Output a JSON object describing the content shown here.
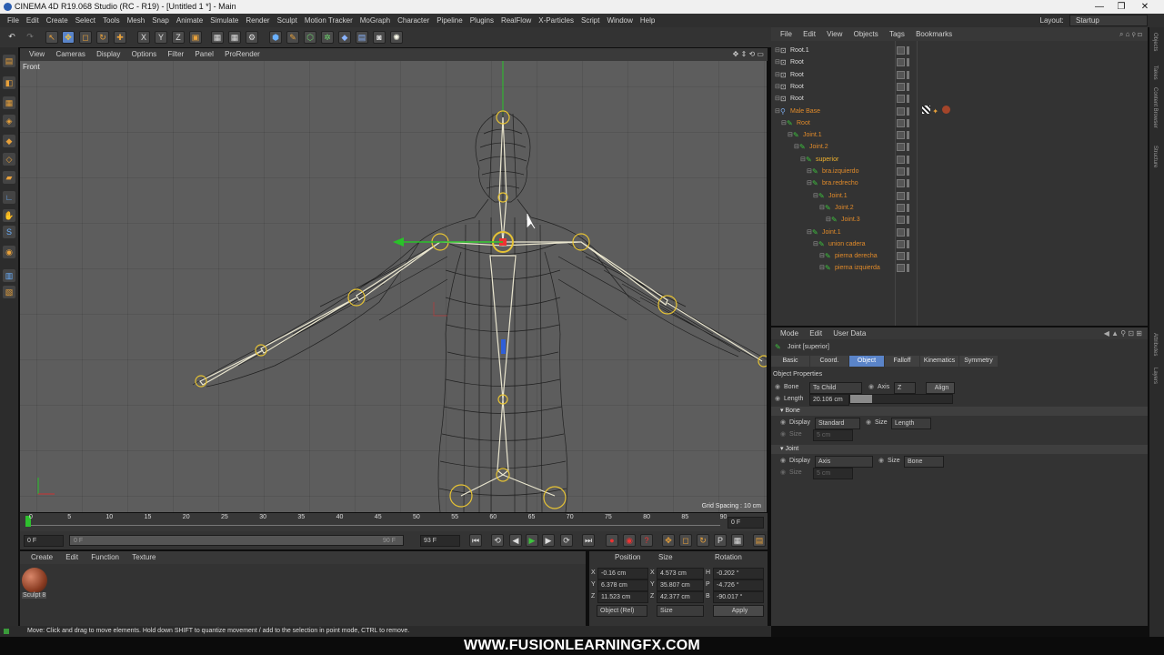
{
  "window": {
    "title": "CINEMA 4D R19.068 Studio (RC - R19) - [Untitled 1 *] - Main",
    "minimize": "—",
    "restore": "❐",
    "close": "✕"
  },
  "menubar": {
    "items": [
      "File",
      "Edit",
      "Create",
      "Select",
      "Tools",
      "Mesh",
      "Snap",
      "Animate",
      "Simulate",
      "Render",
      "Sculpt",
      "Motion Tracker",
      "MoGraph",
      "Character",
      "Pipeline",
      "Plugins",
      "RealFlow",
      "X-Particles",
      "Script",
      "Window",
      "Help"
    ],
    "layout_label": "Layout:",
    "layout_value": "Startup"
  },
  "viewport": {
    "menu": [
      "View",
      "Cameras",
      "Display",
      "Options",
      "Filter",
      "Panel",
      "ProRender"
    ],
    "view_name": "Front",
    "grid_spacing": "Grid Spacing : 10 cm"
  },
  "timeline": {
    "ticks": [
      "0",
      "5",
      "10",
      "15",
      "20",
      "25",
      "30",
      "35",
      "40",
      "45",
      "50",
      "55",
      "60",
      "65",
      "70",
      "75",
      "80",
      "85",
      "90"
    ],
    "end_field": "0 F"
  },
  "transport": {
    "start": "0 F",
    "slider_left": "0 F",
    "slider_right": "90 F",
    "end": "93 F"
  },
  "material_manager": {
    "menu": [
      "Create",
      "Edit",
      "Function",
      "Texture"
    ],
    "material_name": "Sculpt 8"
  },
  "coordinates": {
    "headers": [
      "Position",
      "Size",
      "Rotation"
    ],
    "rows": [
      {
        "axis": "X",
        "pos": "-0.16 cm",
        "size_axis": "X",
        "size": "4.573 cm",
        "rot_axis": "H",
        "rot": "-0.202 °"
      },
      {
        "axis": "Y",
        "pos": "6.378 cm",
        "size_axis": "Y",
        "size": "35.807 cm",
        "rot_axis": "P",
        "rot": "-4.726 °"
      },
      {
        "axis": "Z",
        "pos": "11.523 cm",
        "size_axis": "Z",
        "size": "42.377 cm",
        "rot_axis": "B",
        "rot": "-90.017 °"
      }
    ],
    "mode": "Object (Rel)",
    "size_mode": "Size",
    "apply": "Apply"
  },
  "status": "Move: Click and drag to move elements. Hold down SHIFT to quantize movement / add to the selection in point mode, CTRL to remove.",
  "watermark": "WWW.FUSIONLEARNINGFX.COM",
  "object_manager": {
    "menu": [
      "File",
      "Edit",
      "View",
      "Objects",
      "Tags",
      "Bookmarks"
    ],
    "rows": [
      {
        "name": "Root.1",
        "indent": 0,
        "color": "#dcdcdc"
      },
      {
        "name": "Root",
        "indent": 0,
        "color": "#dcdcdc"
      },
      {
        "name": "Root",
        "indent": 0,
        "color": "#dcdcdc"
      },
      {
        "name": "Root",
        "indent": 0,
        "color": "#dcdcdc"
      },
      {
        "name": "Root",
        "indent": 0,
        "color": "#dcdcdc"
      },
      {
        "name": "Male Base",
        "indent": 0,
        "color": "#e08a2a"
      },
      {
        "name": "Root",
        "indent": 1,
        "color": "#e08a2a"
      },
      {
        "name": "Joint.1",
        "indent": 2,
        "color": "#e08a2a"
      },
      {
        "name": "Joint.2",
        "indent": 3,
        "color": "#e08a2a"
      },
      {
        "name": "superior",
        "indent": 4,
        "color": "#f0b22e"
      },
      {
        "name": "bra.izquierdo",
        "indent": 5,
        "color": "#e08a2a"
      },
      {
        "name": "bra.redrecho",
        "indent": 5,
        "color": "#e08a2a"
      },
      {
        "name": "Joint.1",
        "indent": 6,
        "color": "#e08a2a"
      },
      {
        "name": "Joint.2",
        "indent": 7,
        "color": "#e08a2a"
      },
      {
        "name": "Joint.3",
        "indent": 8,
        "color": "#e08a2a"
      },
      {
        "name": "Joint.1",
        "indent": 5,
        "color": "#e08a2a"
      },
      {
        "name": "union cadera",
        "indent": 6,
        "color": "#e08a2a"
      },
      {
        "name": "pierna derecha",
        "indent": 7,
        "color": "#e08a2a"
      },
      {
        "name": "pierna izquierda",
        "indent": 7,
        "color": "#e08a2a"
      }
    ]
  },
  "attributes": {
    "menu": [
      "Mode",
      "Edit",
      "User Data"
    ],
    "object_title": "Joint [superior]",
    "tabs": [
      "Basic",
      "Coord.",
      "Object",
      "Falloff",
      "Kinematics",
      "Symmetry"
    ],
    "active_tab": "Object",
    "section_title": "Object Properties",
    "bone_label": "Bone",
    "bone_value": "To Child",
    "axis_label": "Axis",
    "axis_value": "Z",
    "align": "Align",
    "length_label": "Length",
    "length_value": "20.106 cm",
    "bone_section": "Bone",
    "display_label": "Display",
    "bone_display": "Standard",
    "size_label": "Size",
    "bone_size": "Length",
    "bone_size_field": "5 cm",
    "joint_section": "Joint",
    "joint_display": "Axis",
    "joint_size": "Bone",
    "joint_size_field": "5 cm"
  },
  "right_strip": [
    "Objects",
    "Takes",
    "Content Browser",
    "Structure",
    "Attributes",
    "Layers"
  ]
}
